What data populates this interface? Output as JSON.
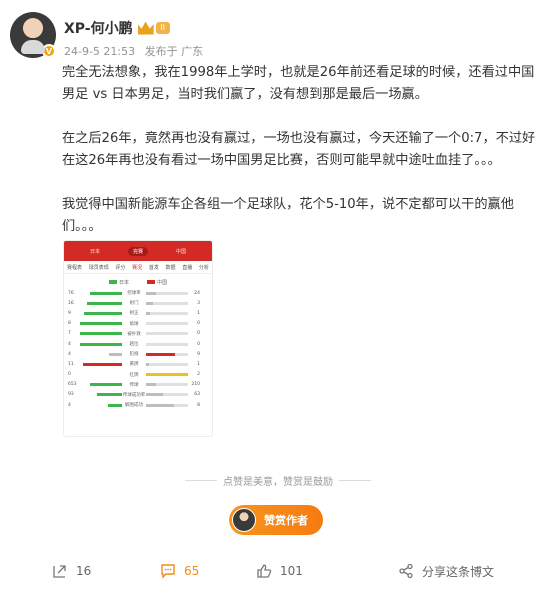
{
  "post": {
    "author": "XP-何小鹏",
    "level": "II",
    "time": "24-9-5 21:53",
    "source": "发布于 广东",
    "paragraphs": [
      "完全无法想象，我在1998年上学时，也就是26年前还看足球的时候，还看过中国男足 vs 日本男足，当时我们赢了，没有想到那是最后一场赢。",
      "在之后26年，竟然再也没有赢过，一场也没有赢过，今天还输了一个0:7，不过好在这26年再也没有看过一场中国男足比赛，否则可能早就中途吐血挂了。。。",
      "我觉得中国新能源车企各组一个足球队，花个5-10年，说不定都可以干的赢他们。。。"
    ]
  },
  "image": {
    "top_labels": [
      "日本",
      "完赛",
      "中国"
    ],
    "tabs": [
      "赛程表",
      "球员表现",
      "评分",
      "赛况",
      "首发",
      "数据",
      "直播",
      "分析"
    ],
    "active_tab": 3,
    "legend_left": "日本",
    "legend_right": "中国",
    "stats": [
      {
        "l": "76",
        "n": "控球率",
        "r": "24",
        "lf": 0.76,
        "rf": 0.24,
        "lc": "#3cb54a",
        "rc": "#bdbdbd"
      },
      {
        "l": "16",
        "n": "射门",
        "r": "3",
        "lf": 0.84,
        "rf": 0.16,
        "lc": "#3cb54a",
        "rc": "#bdbdbd"
      },
      {
        "l": "9",
        "n": "射正",
        "r": "1",
        "lf": 0.9,
        "rf": 0.1,
        "lc": "#3cb54a",
        "rc": "#bdbdbd"
      },
      {
        "l": "8",
        "n": "角球",
        "r": "0",
        "lf": 1.0,
        "rf": 0.0,
        "lc": "#3cb54a",
        "rc": "#bdbdbd"
      },
      {
        "l": "7",
        "n": "被扑救",
        "r": "0",
        "lf": 1.0,
        "rf": 0.0,
        "lc": "#3cb54a",
        "rc": "#bdbdbd"
      },
      {
        "l": "4",
        "n": "越位",
        "r": "0",
        "lf": 1.0,
        "rf": 0.0,
        "lc": "#3cb54a",
        "rc": "#bdbdbd"
      },
      {
        "l": "4",
        "n": "犯规",
        "r": "9",
        "lf": 0.31,
        "rf": 0.69,
        "lc": "#bdbdbd",
        "rc": "#d32a26"
      },
      {
        "l": "11",
        "n": "黄牌",
        "r": "1",
        "lf": 0.92,
        "rf": 0.08,
        "lc": "#d32a26",
        "rc": "#bdbdbd"
      },
      {
        "l": "0",
        "n": "红牌",
        "r": "2",
        "lf": 0.0,
        "rf": 1.0,
        "lc": "#bdbdbd",
        "rc": "#e8c21f"
      },
      {
        "l": "653",
        "n": "传球",
        "r": "210",
        "lf": 0.76,
        "rf": 0.24,
        "lc": "#3cb54a",
        "rc": "#bdbdbd"
      },
      {
        "l": "93",
        "n": "传球成功率",
        "r": "63",
        "lf": 0.6,
        "rf": 0.4,
        "lc": "#3cb54a",
        "rc": "#bdbdbd"
      },
      {
        "l": "4",
        "n": "解围成功",
        "r": "8",
        "lf": 0.33,
        "rf": 0.67,
        "lc": "#3cb54a",
        "rc": "#bdbdbd"
      }
    ]
  },
  "reward": {
    "hint": "点赞是美意，赞赏是鼓励",
    "button": "赞赏作者"
  },
  "actions": {
    "repost": "16",
    "comment": "65",
    "like": "101",
    "share": "分享这条博文"
  },
  "colors": {
    "accent": "#f48a19",
    "red": "#d32a26",
    "green": "#3cb54a"
  }
}
